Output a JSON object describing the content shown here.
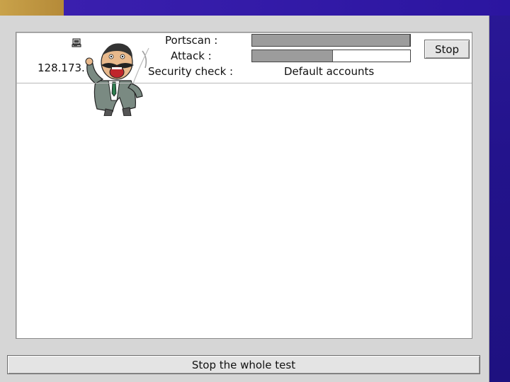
{
  "host": {
    "ip_text": "128.173.",
    "icon": "computer-icon"
  },
  "mascot": {
    "icon": "shouting-character-icon"
  },
  "scan": {
    "portscan_label": "Portscan :",
    "portscan_progress": 1.0,
    "attack_label": "Attack :",
    "attack_progress": 0.51,
    "security_check_label": "Security check :",
    "security_check_value": "Default accounts"
  },
  "buttons": {
    "stop": "Stop",
    "stop_all": "Stop the whole test"
  },
  "colors": {
    "slide_background": "#23138c",
    "slide_accent": "#c9a24a",
    "window": "#d6d6d6",
    "progress_fill": "#9c9c9c"
  }
}
